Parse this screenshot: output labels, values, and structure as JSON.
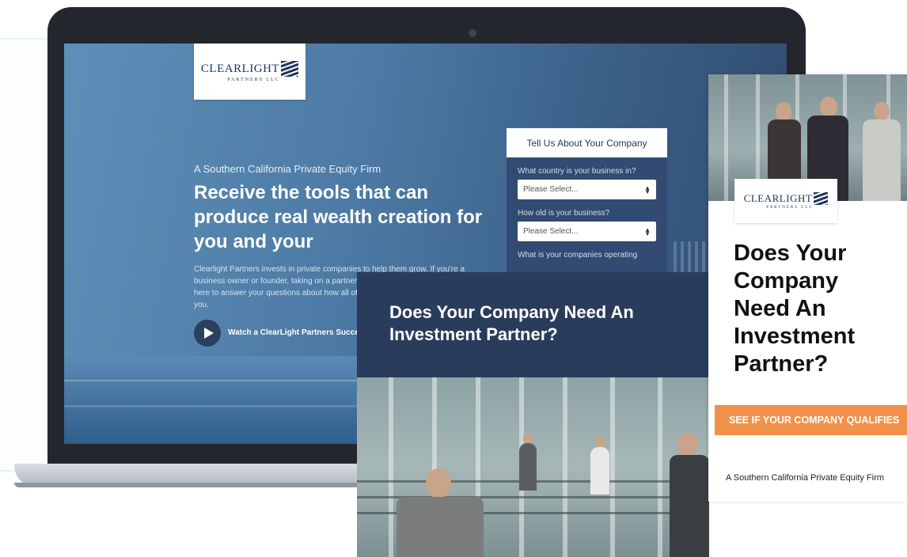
{
  "brand": {
    "logo_word": "CLEARLIGHT",
    "logo_sub": "PARTNERS LLC",
    "colors": {
      "navy": "#2a3c5c",
      "accent_orange": "#f2914a",
      "form_blue": "#314b72"
    }
  },
  "landing": {
    "tagline": "A Southern California Private Equity Firm",
    "headline": "Receive the tools that can produce real wealth creation for you and your",
    "body": "Clearlight Partners invests in private companies to help them grow. If you're a business owner or founder, taking on a partner can create a lot of uncertainty. We're here to answer your questions about how all of this works and what it can mean for you.",
    "watch_label": "Watch a ClearLight Partners Success Story",
    "play_icon": "play-icon"
  },
  "form": {
    "title": "Tell Us About Your Company",
    "q1_label": "What country is your business in?",
    "q1_value": "Please Select...",
    "q2_label": "How old is your business?",
    "q2_value": "Please Select...",
    "q3_label": "What is your companies operating"
  },
  "ad_mid": {
    "title": "Does Your Company Need An Investment Partner?"
  },
  "ad_right": {
    "title": "Does Your Company Need An Investment Partner?",
    "cta": "SEE IF YOUR COMPANY QUALIFIES",
    "tagline": "A Southern California Private Equity Firm"
  }
}
